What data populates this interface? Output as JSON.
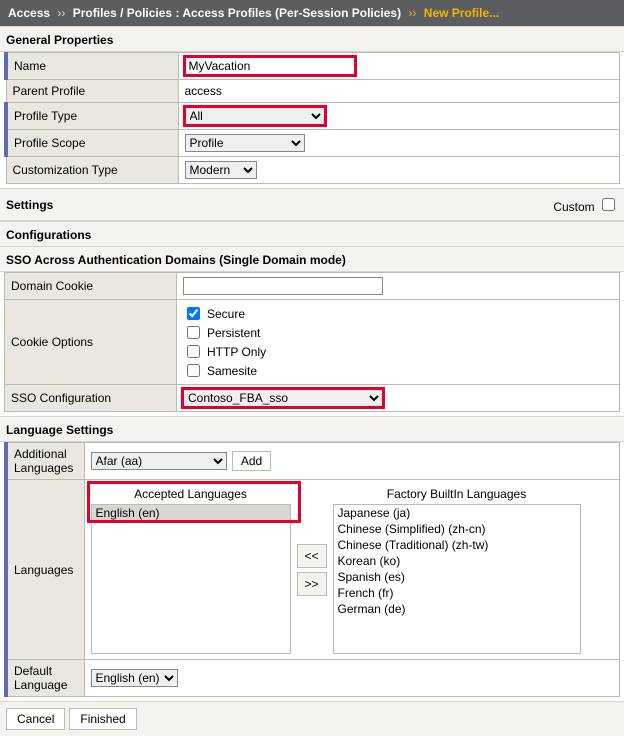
{
  "breadcrumb": {
    "root": "Access",
    "mid": "Profiles / Policies : Access Profiles (Per-Session Policies)",
    "leaf": "New Profile..."
  },
  "sections": {
    "general": "General Properties",
    "settings": "Settings",
    "custom_label": "Custom",
    "configs": "Configurations",
    "sso_header": "SSO Across Authentication Domains (Single Domain mode)",
    "lang": "Language Settings"
  },
  "general": {
    "name_label": "Name",
    "name_value": "MyVacation",
    "parent_label": "Parent Profile",
    "parent_value": "access",
    "type_label": "Profile Type",
    "type_value": "All",
    "scope_label": "Profile Scope",
    "scope_value": "Profile",
    "cust_label": "Customization Type",
    "cust_value": "Modern"
  },
  "sso": {
    "domain_cookie_label": "Domain Cookie",
    "domain_cookie_value": "",
    "cookie_opts_label": "Cookie Options",
    "opts": {
      "secure": "Secure",
      "persistent": "Persistent",
      "httponly": "HTTP Only",
      "samesite": "Samesite"
    },
    "checked": {
      "secure": true,
      "persistent": false,
      "httponly": false,
      "samesite": false
    },
    "sso_conf_label": "SSO Configuration",
    "sso_conf_value": "Contoso_FBA_sso"
  },
  "lang": {
    "add_label": "Additional Languages",
    "add_value": "Afar (aa)",
    "add_btn": "Add",
    "langs_label": "Languages",
    "accepted_title": "Accepted Languages",
    "accepted_items": [
      "English (en)"
    ],
    "factory_title": "Factory BuiltIn Languages",
    "factory_items": [
      "Japanese (ja)",
      "Chinese (Simplified) (zh-cn)",
      "Chinese (Traditional) (zh-tw)",
      "Korean (ko)",
      "Spanish (es)",
      "French (fr)",
      "German (de)"
    ],
    "mover_left": "<<",
    "mover_right": ">>",
    "default_label": "Default Language",
    "default_value": "English (en)"
  },
  "footer": {
    "cancel": "Cancel",
    "finished": "Finished"
  }
}
